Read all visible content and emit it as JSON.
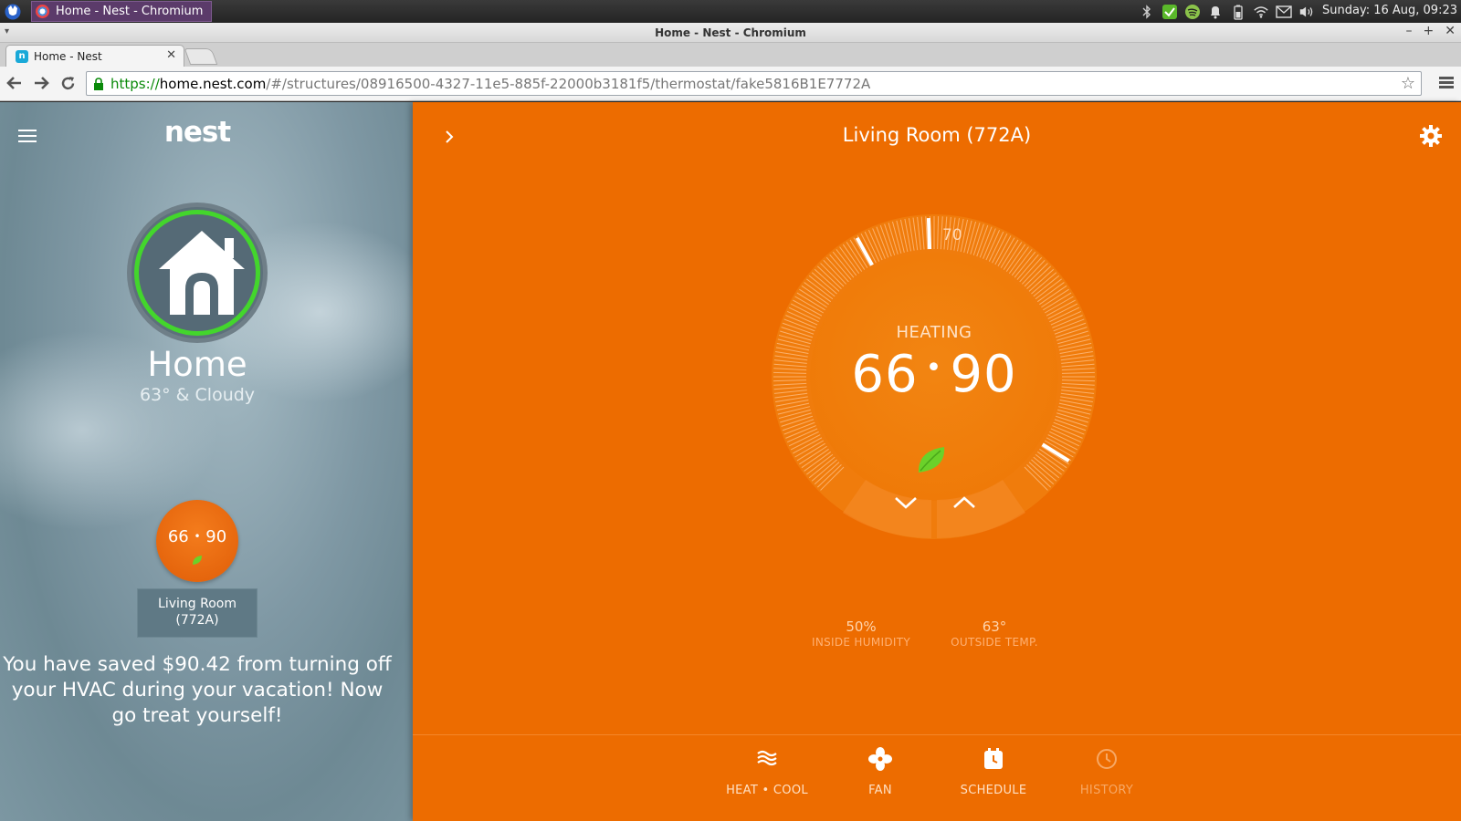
{
  "os_panel": {
    "task_label": "Home - Nest - Chromium",
    "clock": "Sunday:  16 Aug, 09:23"
  },
  "window": {
    "title": "Home - Nest - Chromium",
    "minimize": "–",
    "maximize": "+",
    "close": "✕",
    "menu": "▾"
  },
  "browser": {
    "tab_label": "Home - Nest",
    "tab_close": "✕",
    "url_scheme": "https://",
    "url_host": "home.nest.com",
    "url_path": "/#/structures/08916500-4327-11e5-885f-22000b3181f5/thermostat/fake5816B1E7772A",
    "back": "⬅",
    "forward": "➡",
    "reload": "↻",
    "star": "☆"
  },
  "sidebar": {
    "logo": "nest",
    "home_name": "Home",
    "weather": "63° & Cloudy",
    "mini_thermostat": {
      "low": "66",
      "separator": "•",
      "high": "90"
    },
    "device_label_line1": "Living Room",
    "device_label_line2": "(772A)",
    "savings_message": "You have saved $90.42 from turning off your HVAC during your vacation! Now go treat yourself!"
  },
  "thermostat": {
    "title": "Living Room (772A)",
    "mode": "HEATING",
    "low": "66",
    "separator": "•",
    "high": "90",
    "target_marker": "70",
    "humidity_value": "50%",
    "humidity_label": "INSIDE HUMIDITY",
    "outside_value": "63°",
    "outside_label": "OUTSIDE TEMP.",
    "colors": {
      "background": "#ed6c00",
      "leaf": "#6bd12a",
      "ring_active": "#43d62c"
    }
  },
  "bottom_nav": [
    {
      "label": "HEAT • COOL",
      "icon": "heat-cool-icon"
    },
    {
      "label": "FAN",
      "icon": "fan-icon"
    },
    {
      "label": "SCHEDULE",
      "icon": "schedule-icon"
    },
    {
      "label": "HISTORY",
      "icon": "history-icon"
    }
  ]
}
